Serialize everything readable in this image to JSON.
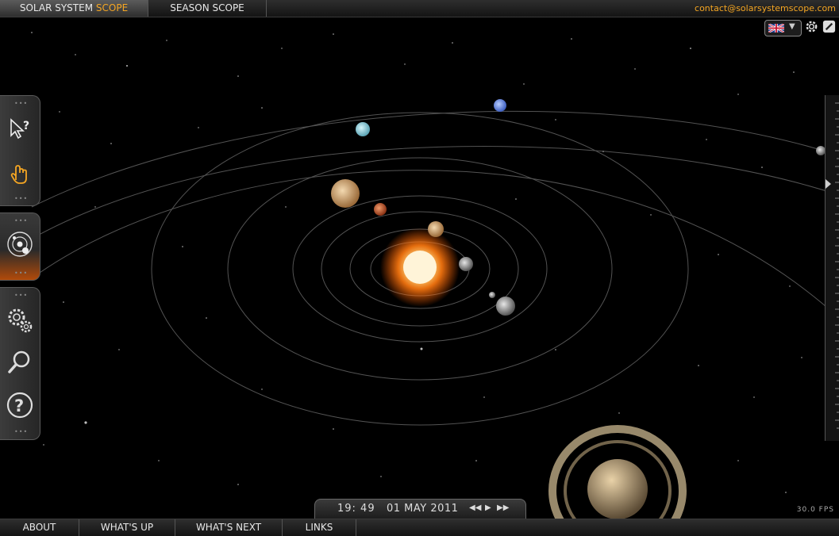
{
  "top_tabs": [
    {
      "label_main": "SOLAR SYSTEM",
      "label_accent": "SCOPE"
    },
    {
      "label": "SEASON SCOPE"
    }
  ],
  "contact": "contact@solarsystemscope.com",
  "icons": {
    "language": "uk-flag-icon",
    "settings": "gear-icon",
    "fullscreen": "fullscreen-icon",
    "tools": [
      "pointer-help-icon",
      "hand-icon",
      "solar-system-icon",
      "settings-gears-icon",
      "search-icon",
      "help-icon"
    ]
  },
  "time": {
    "time": "19: 49",
    "date": "01 MAY 2011",
    "controls": [
      "◀◀",
      "▶",
      "▶▶"
    ]
  },
  "fps": "30.0 FPS",
  "bottom_tabs": [
    "ABOUT",
    "WHAT'S UP",
    "WHAT'S NEXT",
    "LINKS"
  ],
  "colors": {
    "accent": "#f5a623",
    "sun": "#ff8a1a"
  }
}
